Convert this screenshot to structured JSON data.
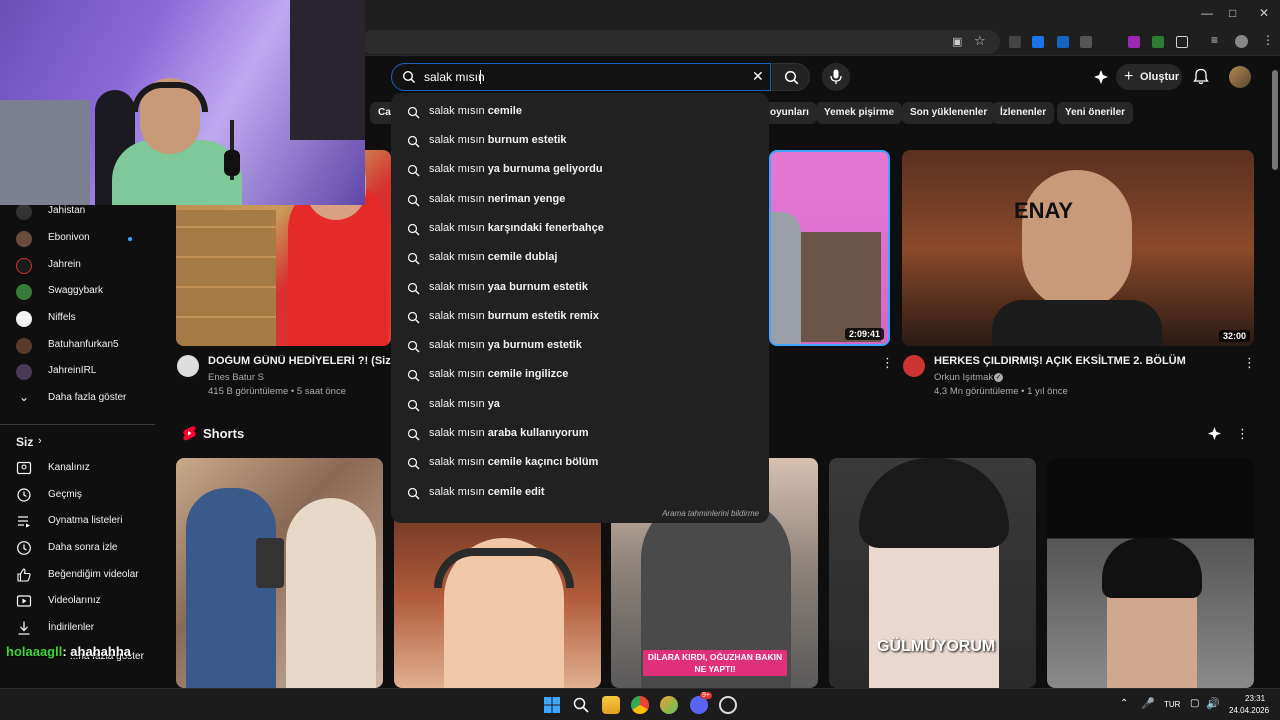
{
  "search": {
    "query": "salak mısın",
    "suggestions": [
      {
        "prefix": "salak mısın ",
        "rest": "cemile"
      },
      {
        "prefix": "salak mısın ",
        "rest": "burnum estetik"
      },
      {
        "prefix": "salak mısın ",
        "rest": "ya burnuma geliyordu"
      },
      {
        "prefix": "salak mısın ",
        "rest": "neriman yenge"
      },
      {
        "prefix": "salak mısın ",
        "rest": "karşındaki fenerbahçe"
      },
      {
        "prefix": "salak mısın ",
        "rest": "cemile dublaj"
      },
      {
        "prefix": "salak mısın ",
        "rest": "yaa burnum estetik"
      },
      {
        "prefix": "salak mısın ",
        "rest": "burnum estetik remix"
      },
      {
        "prefix": "salak mısın ",
        "rest": "ya burnum estetik"
      },
      {
        "prefix": "salak mısın ",
        "rest": "cemile ingilizce"
      },
      {
        "prefix": "salak mısın ",
        "rest": "ya"
      },
      {
        "prefix": "salak mısın ",
        "rest": "araba kullanıyorum"
      },
      {
        "prefix": "salak mısın ",
        "rest": "cemile kaçıncı bölüm"
      },
      {
        "prefix": "salak mısın ",
        "rest": "cemile edit"
      }
    ],
    "report_text": "Arama tahminlerini bildirme"
  },
  "header": {
    "create_label": "Oluştur"
  },
  "chips": [
    "Ca",
    "oyunları",
    "Yemek pişirme",
    "Son yüklenenler",
    "İzlenenler",
    "Yeni öneriler"
  ],
  "subscriptions": [
    {
      "name": "Jahistan",
      "color": "#333"
    },
    {
      "name": "Ebonivon",
      "color": "#6b4b3a"
    },
    {
      "name": "Jahrein",
      "color": "#1a1a1a"
    },
    {
      "name": "Swaggybark",
      "color": "#3a7a3a"
    },
    {
      "name": "Niffels",
      "color": "#f2f2f2"
    },
    {
      "name": "Batuhanfurkan5",
      "color": "#5a3a2a"
    },
    {
      "name": "JahreinIRL",
      "color": "#4a3a5a"
    }
  ],
  "show_more": "Daha fazla göster",
  "you_section": {
    "title": "Siz",
    "items": [
      {
        "label": "Kanalınız",
        "icon": "channel-icon"
      },
      {
        "label": "Geçmiş",
        "icon": "history-icon"
      },
      {
        "label": "Oynatma listeleri",
        "icon": "playlists-icon"
      },
      {
        "label": "Daha sonra izle",
        "icon": "watch-later-icon"
      },
      {
        "label": "Beğendiğim videolar",
        "icon": "thumbs-up-icon"
      },
      {
        "label": "Videolarınız",
        "icon": "your-videos-icon"
      },
      {
        "label": "İndirilenler",
        "icon": "downloads-icon"
      }
    ],
    "partial_label": "...ha fazla göster"
  },
  "videos": [
    {
      "title": "DOĞUM GÜNÜ HEDİYELERİ ?! (Sizden G",
      "channel": "Enes Batur S",
      "meta": "415 B görüntüleme • 5 saat önce",
      "duration": ""
    },
    {
      "title": "",
      "channel": "",
      "meta": "",
      "duration": "2:09:41"
    },
    {
      "title": "HERKES ÇILDIRMIŞ! AÇIK EKSİLTME 2. BÖLÜM",
      "channel": "Orkun Işıtmak",
      "meta": "4,3 Mn görüntüleme • 1 yıl önce",
      "duration": "32:00"
    }
  ],
  "thumb_text": "ENAY",
  "shorts": {
    "title": "Shorts",
    "overlay_texts": [
      "DİLARA KIRDI, OĞUZHAN BAKIN NE YAPTI!",
      "GÜLMÜYORUM"
    ]
  },
  "chat_overlay": {
    "user": "holaaagll",
    "message": ": ahahahha"
  },
  "taskbar": {
    "lang": "TUR",
    "time": "23:31",
    "date": "24.04.2026",
    "discord_badge": "9+"
  },
  "colors": {
    "accent": "#3ea6ff",
    "red": "#ff0000",
    "chat_green": "#3ad93a"
  }
}
